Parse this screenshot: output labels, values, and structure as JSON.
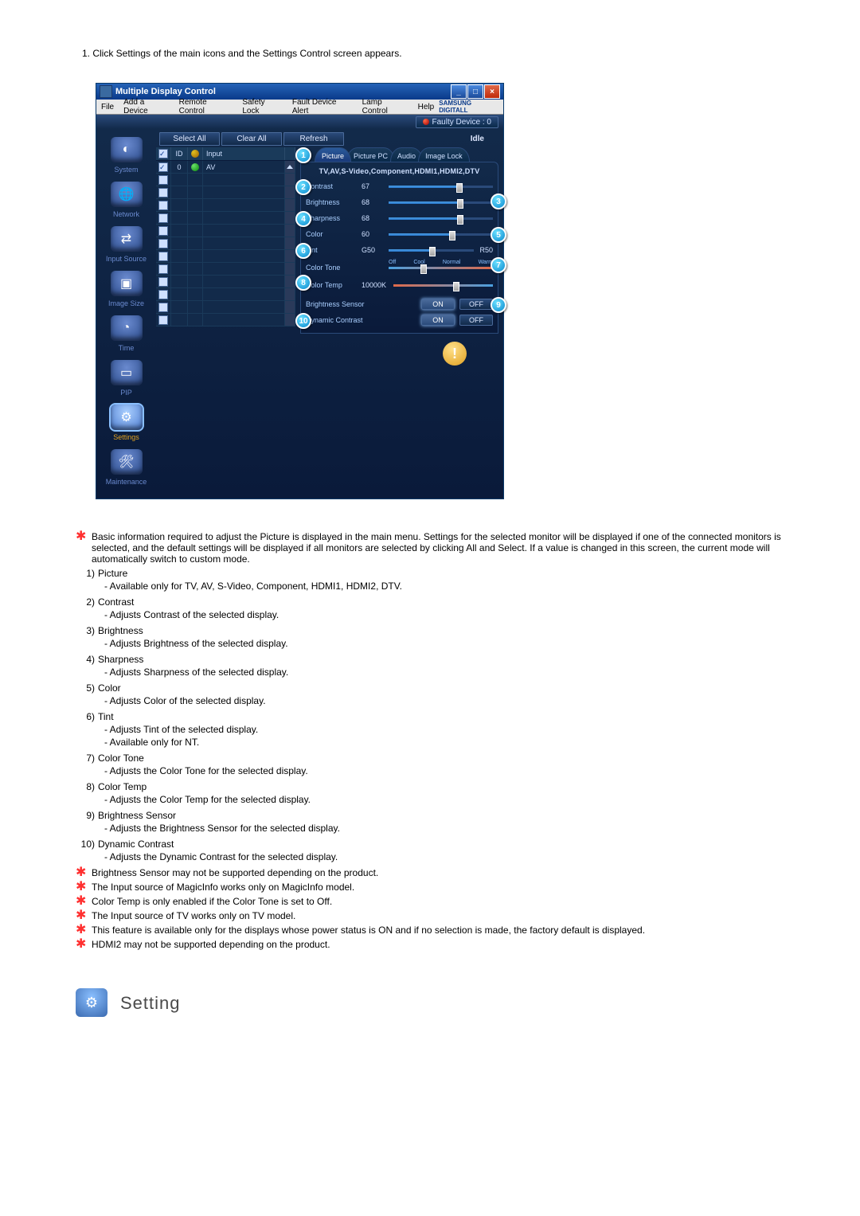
{
  "intro": "1. Click Settings of the main icons and the Settings Control screen appears.",
  "window": {
    "title": "Multiple Display Control",
    "brand": "SAMSUNG DIGITALL"
  },
  "menu": {
    "items": [
      "File",
      "Add a Device",
      "Remote Control",
      "Safety Lock",
      "Fault Device Alert",
      "Lamp Control",
      "Help"
    ]
  },
  "status": {
    "faulty": "Faulty Device : 0"
  },
  "toolbar": {
    "select_all": "Select All",
    "clear_all": "Clear All",
    "refresh": "Refresh",
    "idle": "Idle"
  },
  "sidebar": {
    "items": [
      {
        "label": "System",
        "glyph": "◐"
      },
      {
        "label": "Network",
        "glyph": "🌐"
      },
      {
        "label": "Input Source",
        "glyph": "⇄"
      },
      {
        "label": "Image Size",
        "glyph": "▣"
      },
      {
        "label": "Time",
        "glyph": "◔"
      },
      {
        "label": "PIP",
        "glyph": "▭"
      },
      {
        "label": "Settings",
        "glyph": "⚙"
      },
      {
        "label": "Maintenance",
        "glyph": "🛠"
      }
    ],
    "selected": 6
  },
  "devlist": {
    "headers": {
      "id": "ID",
      "input": "Input"
    },
    "rows": [
      {
        "checked": true,
        "status": "g",
        "id": "0",
        "input": "AV"
      },
      {
        "checked": false,
        "status": "",
        "id": "",
        "input": ""
      },
      {
        "checked": false,
        "status": "",
        "id": "",
        "input": ""
      },
      {
        "checked": false,
        "status": "",
        "id": "",
        "input": ""
      },
      {
        "checked": false,
        "status": "",
        "id": "",
        "input": ""
      },
      {
        "checked": false,
        "status": "",
        "id": "",
        "input": ""
      },
      {
        "checked": false,
        "status": "",
        "id": "",
        "input": ""
      },
      {
        "checked": false,
        "status": "",
        "id": "",
        "input": ""
      },
      {
        "checked": false,
        "status": "",
        "id": "",
        "input": ""
      },
      {
        "checked": false,
        "status": "",
        "id": "",
        "input": ""
      },
      {
        "checked": false,
        "status": "",
        "id": "",
        "input": ""
      },
      {
        "checked": false,
        "status": "",
        "id": "",
        "input": ""
      },
      {
        "checked": false,
        "status": "",
        "id": "",
        "input": ""
      }
    ]
  },
  "tabs": {
    "items": [
      "Picture",
      "Picture PC",
      "Audio",
      "Image Lock"
    ],
    "active": 0
  },
  "panel": {
    "subhead": "TV,AV,S-Video,Component,HDMI1,HDMI2,DTV",
    "contrast": {
      "label": "Contrast",
      "value": "67"
    },
    "brightness": {
      "label": "Brightness",
      "value": "68"
    },
    "sharpness": {
      "label": "Sharpness",
      "value": "68"
    },
    "color": {
      "label": "Color",
      "value": "60"
    },
    "tint": {
      "label": "Tint",
      "value": "G50",
      "right": "R50"
    },
    "colortone": {
      "label": "Color Tone",
      "opts": [
        "Off",
        "Cool",
        "Normal",
        "Warm"
      ]
    },
    "colortemp": {
      "label": "Color Temp",
      "value": "10000K"
    },
    "brightness_sensor": {
      "label": "Brightness Sensor",
      "on": "ON",
      "off": "OFF"
    },
    "dynamic_contrast": {
      "label": "Dynamic Contrast",
      "on": "ON",
      "off": "OFF"
    }
  },
  "callouts": [
    "1",
    "2",
    "3",
    "4",
    "5",
    "6",
    "7",
    "8",
    "9",
    "10"
  ],
  "notes": {
    "star_main": "Basic information required to adjust the Picture is displayed in the main menu. Settings for the selected monitor will be displayed if one of the connected monitors is selected, and the default settings will be displayed if all monitors are selected by clicking All and Select. If a value is changed in this screen, the current mode will automatically switch to custom mode.",
    "items": [
      {
        "n": "1)",
        "label": "Picture",
        "subs": [
          "- Available only for TV, AV, S-Video, Component, HDMI1, HDMI2, DTV."
        ]
      },
      {
        "n": "2)",
        "label": "Contrast",
        "subs": [
          "- Adjusts Contrast of the selected display."
        ]
      },
      {
        "n": "3)",
        "label": "Brightness",
        "subs": [
          "- Adjusts Brightness of the selected display."
        ]
      },
      {
        "n": "4)",
        "label": "Sharpness",
        "subs": [
          "- Adjusts Sharpness of the selected display."
        ]
      },
      {
        "n": "5)",
        "label": "Color",
        "subs": [
          "- Adjusts Color of the selected display."
        ]
      },
      {
        "n": "6)",
        "label": "Tint",
        "subs": [
          "- Adjusts Tint of the selected display.",
          "- Available  only for NT."
        ]
      },
      {
        "n": "7)",
        "label": "Color Tone",
        "subs": [
          "- Adjusts the Color Tone for the selected display."
        ]
      },
      {
        "n": "8)",
        "label": "Color Temp",
        "subs": [
          "- Adjusts the Color Temp for the selected display."
        ]
      },
      {
        "n": "9)",
        "label": "Brightness Sensor",
        "subs": [
          "- Adjusts the Brightness Sensor for the selected display."
        ]
      },
      {
        "n": "10)",
        "label": "Dynamic Contrast",
        "subs": [
          "- Adjusts the Dynamic Contrast for the selected display."
        ]
      }
    ],
    "stars": [
      "Brightness Sensor may not be supported depending on the product.",
      "The Input source of MagicInfo works only on MagicInfo model.",
      "Color Temp is only enabled if the Color Tone is set to Off.",
      "The Input source of TV works only on TV model.",
      "This feature is available only for the displays whose power status is ON and if no selection is made, the factory default is displayed.",
      "HDMI2 may not be supported depending on the product."
    ]
  },
  "section": {
    "title": "Setting"
  }
}
